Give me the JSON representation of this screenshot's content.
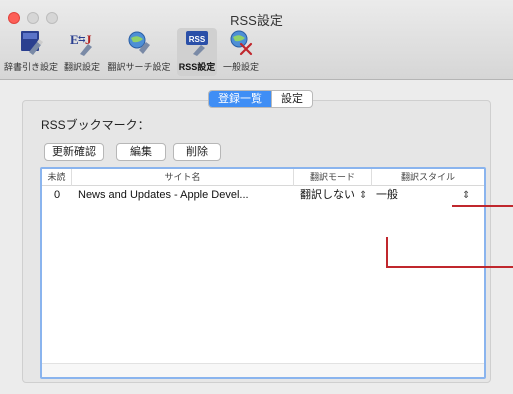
{
  "window": {
    "title": "RSS設定"
  },
  "toolbar": {
    "items": [
      {
        "label": "辞書引き設定",
        "icon": "dictionary-lookup-icon"
      },
      {
        "label": "翻訳設定",
        "icon": "translation-settings-icon"
      },
      {
        "label": "翻訳サーチ設定",
        "icon": "translation-search-icon"
      },
      {
        "label": "RSS設定",
        "icon": "rss-icon",
        "selected": true
      },
      {
        "label": "一般設定",
        "icon": "general-settings-icon"
      }
    ]
  },
  "tabs": {
    "list": "登録一覧",
    "settings": "設定",
    "selected": "登録一覧"
  },
  "bookmarks": {
    "label": "RSSブックマーク：",
    "buttons": {
      "check_updates": "更新確認",
      "edit": "編集",
      "delete": "削除"
    }
  },
  "table": {
    "columns": [
      "未読",
      "サイト名",
      "翻訳モード",
      "翻訳スタイル"
    ],
    "rows": [
      {
        "unread": "0",
        "site": "News and Updates - Apple Devel...",
        "mode": "翻訳しない",
        "style": "一般"
      }
    ]
  },
  "colors": {
    "accent": "#3f8ef5",
    "callout": "#c0272d"
  }
}
